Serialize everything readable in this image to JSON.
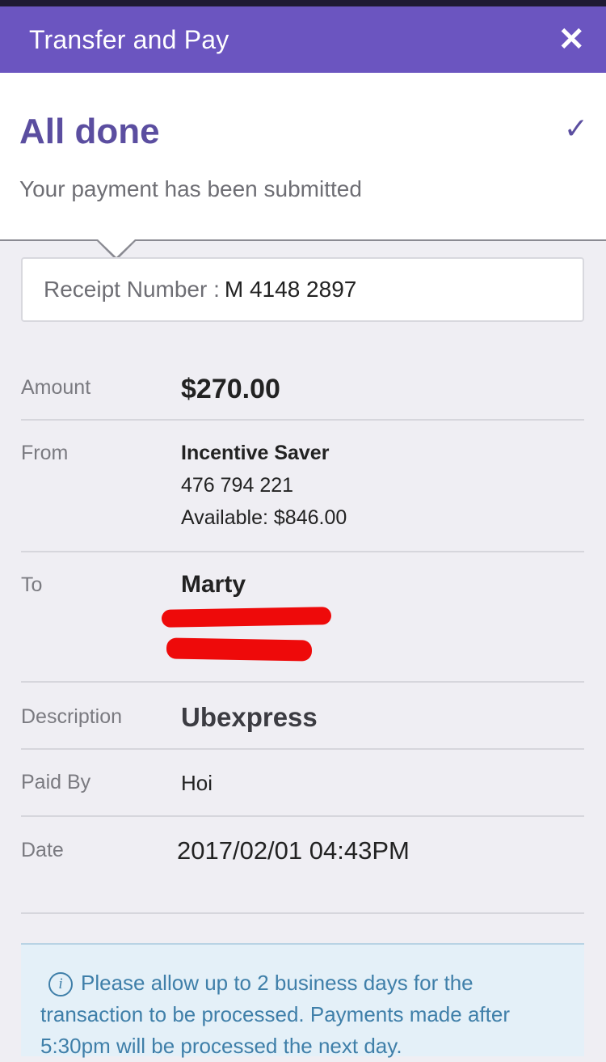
{
  "header": {
    "title": "Transfer and Pay",
    "close_symbol": "✕"
  },
  "status": {
    "title": "All done",
    "check_symbol": "✓",
    "subtitle": "Your payment has been submitted"
  },
  "receipt": {
    "label": "Receipt Number :",
    "value": "M 4148 2897"
  },
  "details": {
    "amount": {
      "label": "Amount",
      "value": "$270.00"
    },
    "from": {
      "label": "From",
      "account_name": "Incentive Saver",
      "account_number": "476 794 221",
      "available": "Available: $846.00"
    },
    "to": {
      "label": "To",
      "name": "Marty"
    },
    "description": {
      "label": "Description",
      "value": "Ubexpress"
    },
    "paid_by": {
      "label": "Paid By",
      "value": "Hoi"
    },
    "date": {
      "label": "Date",
      "value": "2017/02/01 04:43PM"
    }
  },
  "notice": {
    "icon": "info-icon",
    "text": "Please allow up to 2 business days for the transaction to be processed. Payments made after 5:30pm will be processed the next day."
  },
  "colors": {
    "header": "#6b55c0",
    "accent": "#5b4ea0",
    "redaction": "#ee0a0a",
    "notice_text": "#3f7fa9",
    "notice_bg": "#e4f0f8"
  }
}
